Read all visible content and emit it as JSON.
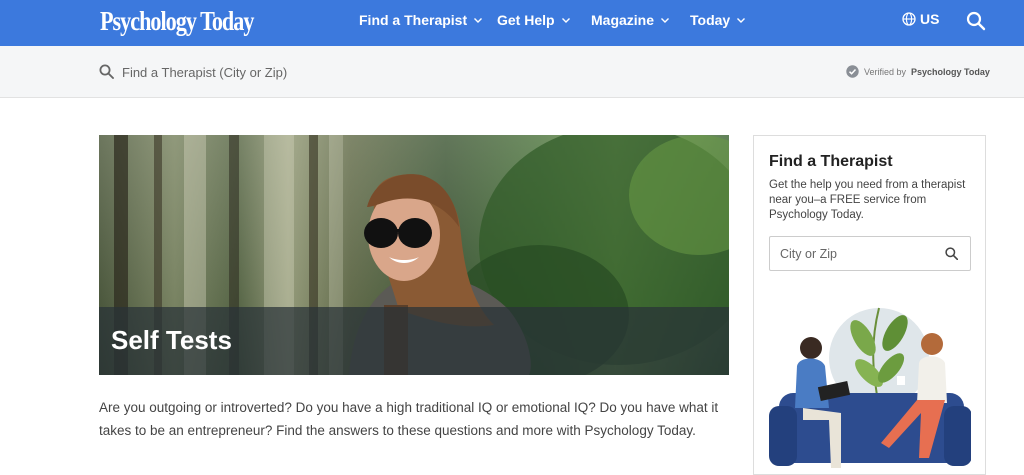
{
  "header": {
    "logo": "Psychology Today",
    "nav": [
      {
        "label": "Find a Therapist"
      },
      {
        "label": "Get Help"
      },
      {
        "label": "Magazine"
      },
      {
        "label": "Today"
      }
    ],
    "region": "US",
    "bg_color": "#3c79dd"
  },
  "search": {
    "placeholder": "Find a Therapist (City or Zip)",
    "verified_prefix": "Verified by",
    "verified_brand": "Psychology Today"
  },
  "hero": {
    "title": "Self Tests"
  },
  "intro": "Are you outgoing or introverted? Do you have a high traditional IQ or emotional IQ? Do you have what it takes to be an entrepreneur? Find the answers to these questions and more with Psychology Today.",
  "sidebar": {
    "title": "Find a Therapist",
    "description": "Get the help you need from a therapist near you–a FREE service from Psychology Today.",
    "input_placeholder": "City or Zip"
  }
}
